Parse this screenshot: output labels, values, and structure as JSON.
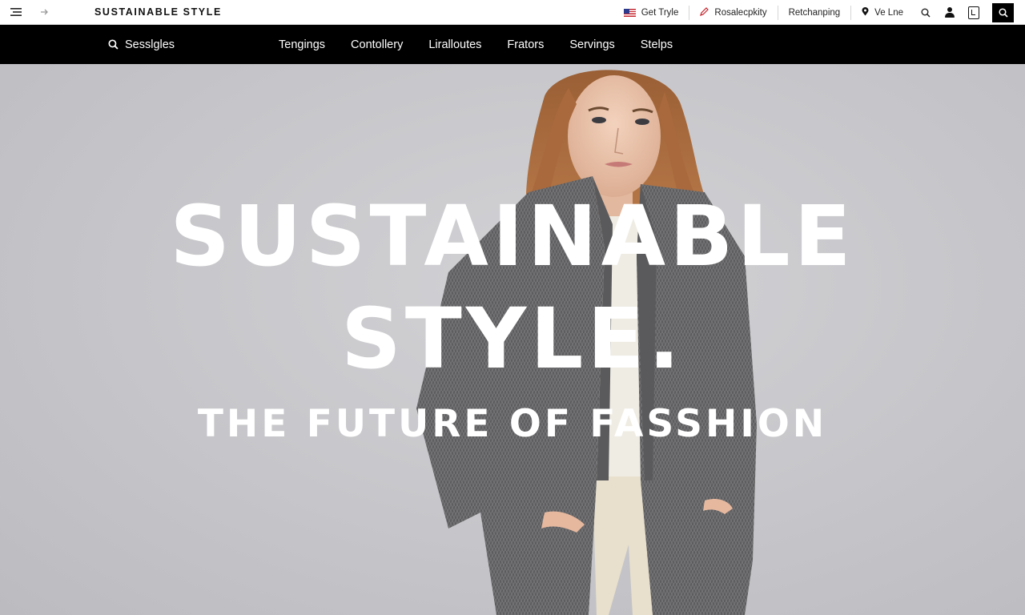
{
  "header": {
    "brand": "SUSTAINABLE STYLE",
    "utility_links": [
      {
        "label": "Get Tryle",
        "icon": "us-flag-icon"
      },
      {
        "label": "Rosalecpkity",
        "icon": "pencil-icon"
      },
      {
        "label": "Retchanping",
        "icon": ""
      },
      {
        "label": "Ve Lne",
        "icon": "location-pin-icon"
      }
    ],
    "icons": [
      "menu-icon",
      "forward-arrow-icon",
      "search-icon",
      "user-icon",
      "bag-icon",
      "search-icon"
    ]
  },
  "nav": {
    "search_label": "Sesslgles",
    "items": [
      "Tengings",
      "Contollery",
      "Liralloutes",
      "Frators",
      "Servings",
      "Stelps"
    ]
  },
  "hero": {
    "headline_line1": "SUSTAINABLE",
    "headline_line2": "STYLE.",
    "subheadline": "THE FUTURE OF FASSHION"
  },
  "colors": {
    "nav_background": "#000000",
    "hero_background": "#c8c8cc",
    "headline_text": "#ffffff",
    "coat": "#6e6e70"
  }
}
